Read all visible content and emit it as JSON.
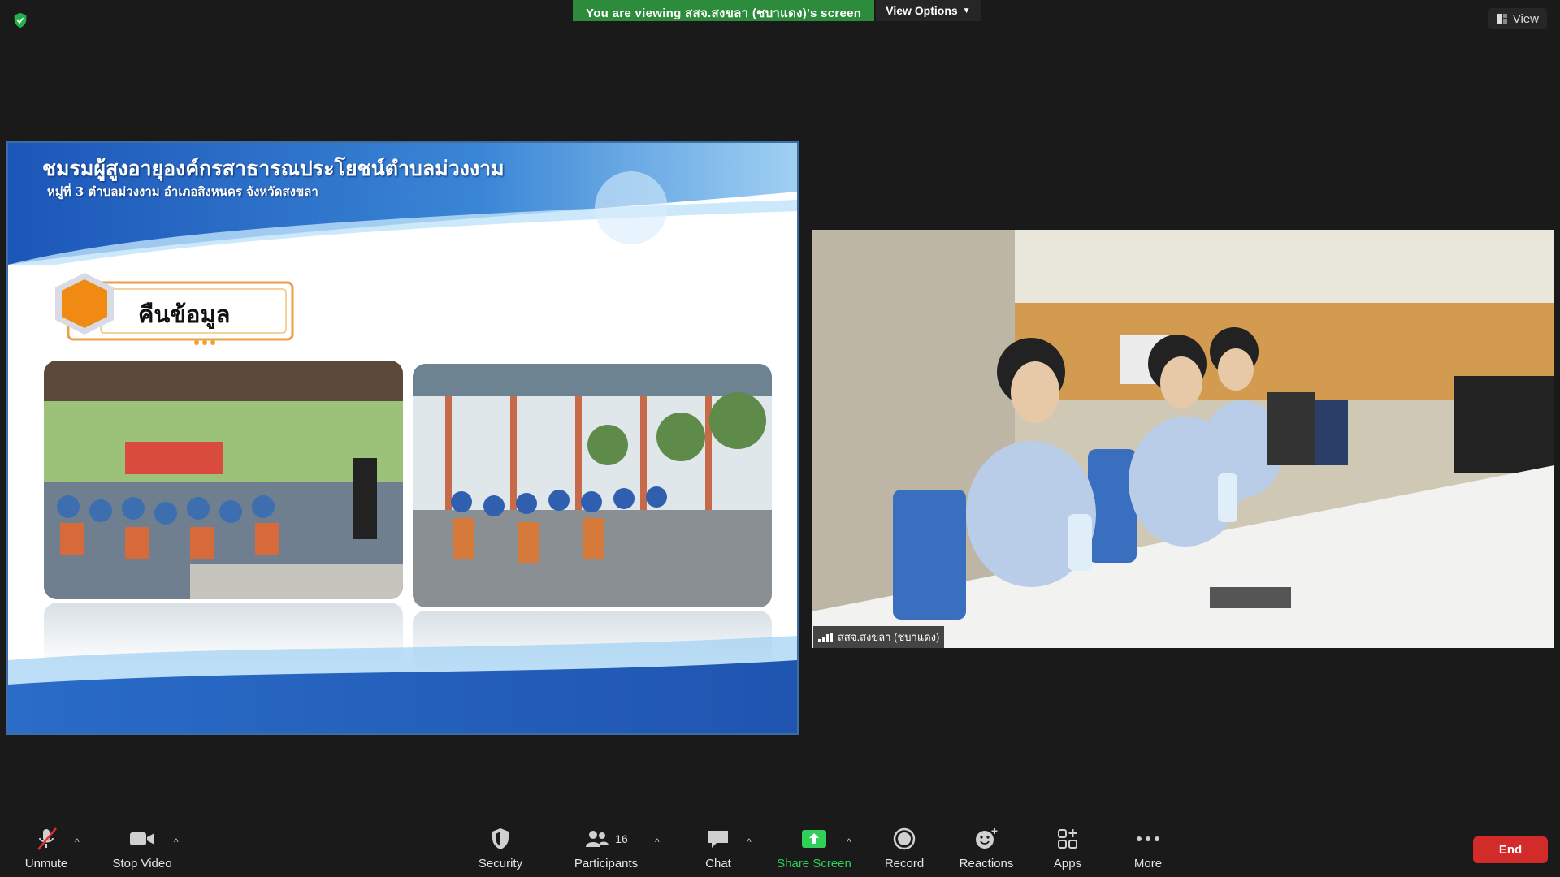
{
  "top": {
    "viewing_text": "You are viewing สสจ.สงขลา (ชบาแดง)'s screen",
    "view_options_label": "View Options",
    "view_button_label": "View"
  },
  "slide": {
    "title": "ชมรมผู้สูงอายุองค์กรสาธารณประโยชน์ตำบลม่วงงาม",
    "subtitle": "หมู่ที่ 3 ตำบลม่วงงาม อำเภอสิงหนคร จังหวัดสงขลา",
    "badge_label": "คืนข้อมูล"
  },
  "video": {
    "participant_name": "สสจ.สงขลา (ชบาแดง)"
  },
  "toolbar": {
    "unmute": "Unmute",
    "stop_video": "Stop Video",
    "security": "Security",
    "participants": "Participants",
    "participants_count": "16",
    "chat": "Chat",
    "share_screen": "Share Screen",
    "record": "Record",
    "reactions": "Reactions",
    "apps": "Apps",
    "more": "More",
    "end": "End"
  },
  "colors": {
    "share_green": "#2fd05a",
    "banner_green": "#2d8c3c",
    "end_red": "#d32a2a",
    "background": "#1a1a1a"
  }
}
